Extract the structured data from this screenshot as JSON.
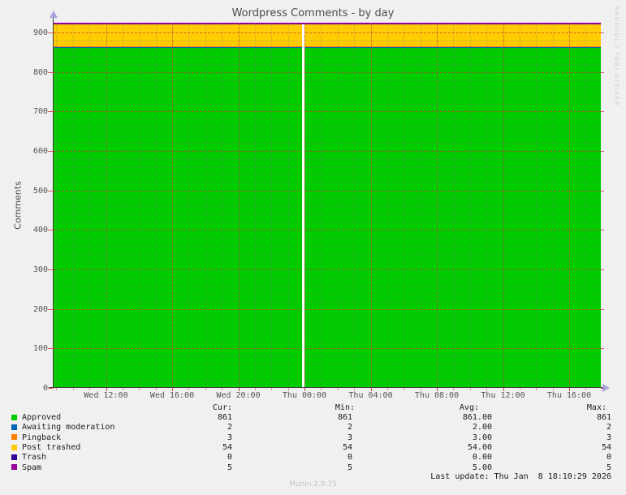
{
  "title": "Wordpress Comments - by day",
  "y_axis_label": "Comments",
  "watermark": "RRDTOOL / TOBI OETIKER",
  "footer": "Munin 2.0.75",
  "last_update": "Last update: Thu Jan  8 18:10:29 2026",
  "chart_data": {
    "type": "area",
    "stacked": true,
    "title": "Wordpress Comments - by day",
    "xlabel": "",
    "ylabel": "Comments",
    "ylim": [
      0,
      925
    ],
    "y_ticks": [
      0,
      100,
      200,
      300,
      400,
      500,
      600,
      700,
      800,
      900
    ],
    "x_ticks": [
      "Wed 12:00",
      "Wed 16:00",
      "Wed 20:00",
      "Thu 00:00",
      "Thu 04:00",
      "Thu 08:00",
      "Thu 12:00",
      "Thu 16:00"
    ],
    "grid": true,
    "legend_position": "bottom",
    "gap_x_fraction": 0.454,
    "series": [
      {
        "name": "Approved",
        "color": "#00cc00",
        "value": 861
      },
      {
        "name": "Awaiting moderation",
        "color": "#0066b3",
        "value": 2
      },
      {
        "name": "Pingback",
        "color": "#ff8000",
        "value": 3
      },
      {
        "name": "Post trashed",
        "color": "#ffcc00",
        "value": 54
      },
      {
        "name": "Trash",
        "color": "#330099",
        "value": 0
      },
      {
        "name": "Spam",
        "color": "#990099",
        "value": 5
      }
    ]
  },
  "legend": {
    "columns": [
      "Cur:",
      "Min:",
      "Avg:",
      "Max:"
    ],
    "rows": [
      {
        "label": "Approved",
        "color": "#00cc00",
        "cur": "861",
        "min": "861",
        "avg": "861.00",
        "max": "861"
      },
      {
        "label": "Awaiting moderation",
        "color": "#0066b3",
        "cur": "2",
        "min": "2",
        "avg": "2.00",
        "max": "2"
      },
      {
        "label": "Pingback",
        "color": "#ff8000",
        "cur": "3",
        "min": "3",
        "avg": "3.00",
        "max": "3"
      },
      {
        "label": "Post trashed",
        "color": "#ffcc00",
        "cur": "54",
        "min": "54",
        "avg": "54.00",
        "max": "54"
      },
      {
        "label": "Trash",
        "color": "#330099",
        "cur": "0",
        "min": "0",
        "avg": "0.00",
        "max": "0"
      },
      {
        "label": "Spam",
        "color": "#990099",
        "cur": "5",
        "min": "5",
        "avg": "5.00",
        "max": "5"
      }
    ]
  }
}
